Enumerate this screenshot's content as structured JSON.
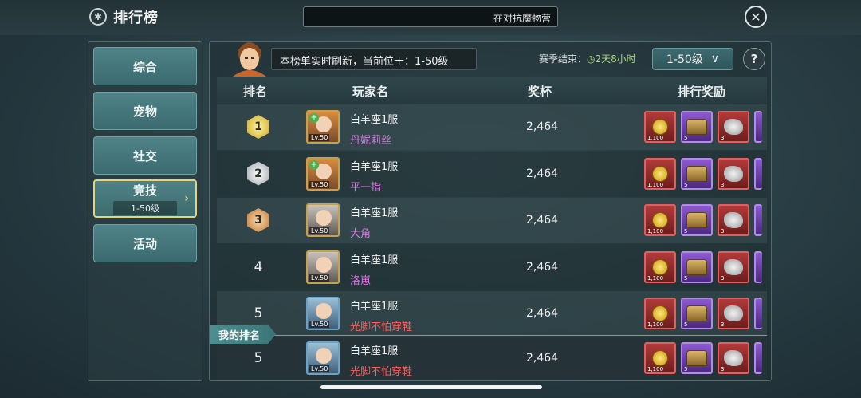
{
  "header": {
    "title": "排行榜",
    "marquee": "在对抗魔物营",
    "close_icon": "close-icon"
  },
  "sidebar": {
    "items": [
      {
        "label": "综合"
      },
      {
        "label": "宠物"
      },
      {
        "label": "社交"
      },
      {
        "label": "竞技",
        "sub": "1-50级",
        "active": true
      },
      {
        "label": "活动"
      }
    ]
  },
  "info": {
    "notice": "本榜单实时刷新，当前位于：1-50级",
    "season_label": "赛季结束：",
    "season_time": "2天8小时",
    "range_value": "1-50级",
    "help": "?"
  },
  "table": {
    "headers": {
      "rank": "排名",
      "player": "玩家名",
      "trophy": "奖杯",
      "reward": "排行奖励"
    },
    "rows": [
      {
        "rank": "1",
        "medal": "gold",
        "level": "Lv.50",
        "guild": "白羊座1服",
        "name": "丹妮莉丝",
        "name_color": "purple",
        "trophy": "2,464",
        "rewards": [
          "1,100",
          "5",
          "3"
        ]
      },
      {
        "rank": "2",
        "medal": "silver",
        "level": "Lv.50",
        "guild": "白羊座1服",
        "name": "平一指",
        "name_color": "purple",
        "trophy": "2,464",
        "rewards": [
          "1,100",
          "5",
          "3"
        ]
      },
      {
        "rank": "3",
        "medal": "bronze",
        "level": "Lv.50",
        "guild": "白羊座1服",
        "name": "大角",
        "name_color": "purple",
        "trophy": "2,464",
        "rewards": [
          "1,100",
          "5",
          "3"
        ]
      },
      {
        "rank": "4",
        "medal": "",
        "level": "Lv.50",
        "guild": "白羊座1服",
        "name": "洛崽",
        "name_color": "purple",
        "trophy": "2,464",
        "rewards": [
          "1,100",
          "5",
          "3"
        ]
      },
      {
        "rank": "5",
        "medal": "",
        "level": "Lv.50",
        "guild": "白羊座1服",
        "name": "光脚不怕穿鞋",
        "name_color": "red",
        "trophy": "2,464",
        "rewards": [
          "1,100",
          "5",
          "3"
        ]
      }
    ],
    "my_rank": {
      "tag": "我的排名",
      "rank": "5",
      "level": "Lv.50",
      "guild": "白羊座1服",
      "name": "光脚不怕穿鞋",
      "name_color": "red",
      "trophy": "2,464",
      "rewards": [
        "1,100",
        "5",
        "3"
      ]
    }
  }
}
